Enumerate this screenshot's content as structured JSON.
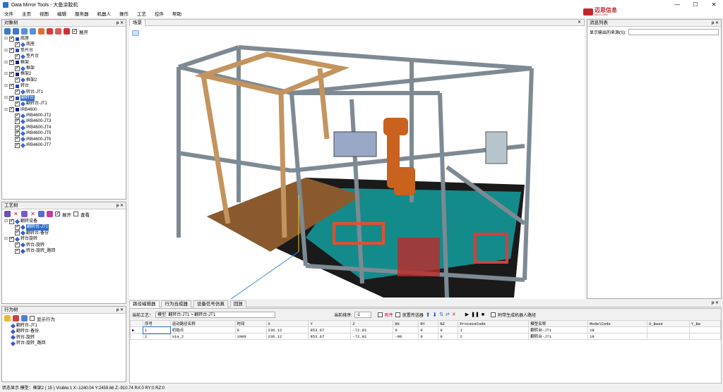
{
  "window": {
    "title": "Data Mirror Tools - 大鱼涂胶机",
    "minimize": "—",
    "maximize": "☐",
    "close": "✕"
  },
  "menu": [
    "文件",
    "主页",
    "视图",
    "编辑",
    "服务器",
    "机器人",
    "操作",
    "工艺",
    "控件",
    "帮助"
  ],
  "brand": {
    "name": "迈思信息",
    "sub": "MAXCOMM"
  },
  "object_tree": {
    "title": "对象树",
    "expand_label": "展开",
    "items": [
      {
        "label": "底座",
        "level": 0,
        "color": "#2244cc"
      },
      {
        "label": "底座",
        "level": 1,
        "color": "#4466dd"
      },
      {
        "label": "垫片台",
        "level": 0,
        "color": "#2244cc"
      },
      {
        "label": "垫片台",
        "level": 1,
        "color": "#4466dd"
      },
      {
        "label": "框架",
        "level": 0,
        "color": "#1a1a8c"
      },
      {
        "label": "框架",
        "level": 1,
        "color": "#4466dd"
      },
      {
        "label": "框架2",
        "level": 0,
        "color": "#1a1a8c"
      },
      {
        "label": "框架2",
        "level": 1,
        "color": "#4466dd"
      },
      {
        "label": "转台",
        "level": 0,
        "color": "#2244cc"
      },
      {
        "label": "转台-JT1",
        "level": 1,
        "color": "#4466dd"
      },
      {
        "label": "翻转台",
        "level": 0,
        "color": "#2244cc",
        "selected": true
      },
      {
        "label": "翻转台-JT1",
        "level": 1,
        "color": "#4466dd"
      },
      {
        "label": "IRB4600",
        "level": 0,
        "color": "#1a1a8c"
      },
      {
        "label": "IRB4600-JT2",
        "level": 1,
        "color": "#4466dd"
      },
      {
        "label": "IRB4600-JT3",
        "level": 1,
        "color": "#4466dd"
      },
      {
        "label": "IRB4600-JT4",
        "level": 1,
        "color": "#4466dd"
      },
      {
        "label": "IRB4600-JT5",
        "level": 1,
        "color": "#4466dd"
      },
      {
        "label": "IRB4600-JT6",
        "level": 1,
        "color": "#4466dd"
      },
      {
        "label": "IRB4600-JT7",
        "level": 1,
        "color": "#4466dd"
      }
    ]
  },
  "process_tree": {
    "title": "工艺树",
    "expand_label": "展开",
    "view_label": "查看",
    "items": [
      {
        "label": "翻转设备",
        "level": 0
      },
      {
        "label": "翻转台-JT1",
        "level": 1,
        "selected": true
      },
      {
        "label": "翻转台-备份",
        "level": 1
      },
      {
        "label": "转台旋转",
        "level": 0
      },
      {
        "label": "转台-旋转",
        "level": 1
      },
      {
        "label": "转台-旋转_路回",
        "level": 1
      }
    ]
  },
  "behavior_tree": {
    "title": "行为树",
    "show_label": "显示行为",
    "items": [
      {
        "label": "翻转台-JT1"
      },
      {
        "label": "翻转台-备份"
      },
      {
        "label": "转台-旋转"
      },
      {
        "label": "转台-旋转_路回"
      }
    ]
  },
  "viewport_tab": "场景",
  "message_panel": {
    "title": "消息列表",
    "filter_label": "显示输出的来源(S):"
  },
  "bottom_tabs": [
    "路径编辑器",
    "行为合成器",
    "设备信号仿真",
    "回放"
  ],
  "path_editor": {
    "current_label": "当前工艺：",
    "current_value": "模型: 翻转台-JT1 > 翻转台-JT1",
    "sort_label": "当前排序:",
    "sort_value": "-1",
    "opt1": "附件",
    "opt2": "放置传送器",
    "gen_label": "附带生成机器人路径",
    "columns": [
      "序号",
      "运动路径名称",
      "时间",
      "X",
      "Y",
      "Z",
      "RX",
      "RY",
      "RZ",
      "ProcessCode",
      "模型名称",
      "ModelCode",
      "X_Base",
      "Y_Ba"
    ],
    "rows": [
      [
        "1",
        "初始点",
        "0",
        "236.12",
        "853.67",
        "-72.81",
        "0",
        "0",
        "0",
        "1",
        "翻转台-JT1",
        "19",
        "",
        ""
      ],
      [
        "2",
        "via_2",
        "1000",
        "236.12",
        "853.67",
        "-72.81",
        "-90",
        "0",
        "0",
        "2",
        "翻转台-JT1",
        "19",
        "",
        ""
      ]
    ]
  },
  "status": "状态显示  模型：框架2 ( 15 )   Visible:1   X:-1240.04   Y:2459.66   Z:-910.74   RX:0   RY:0   RZ:0",
  "colors": {
    "selection": "#2f6fce",
    "frame": "#7d8a93",
    "wood": "#8a5a2e",
    "floor": "#138b8b",
    "robot": "#c8621e"
  }
}
